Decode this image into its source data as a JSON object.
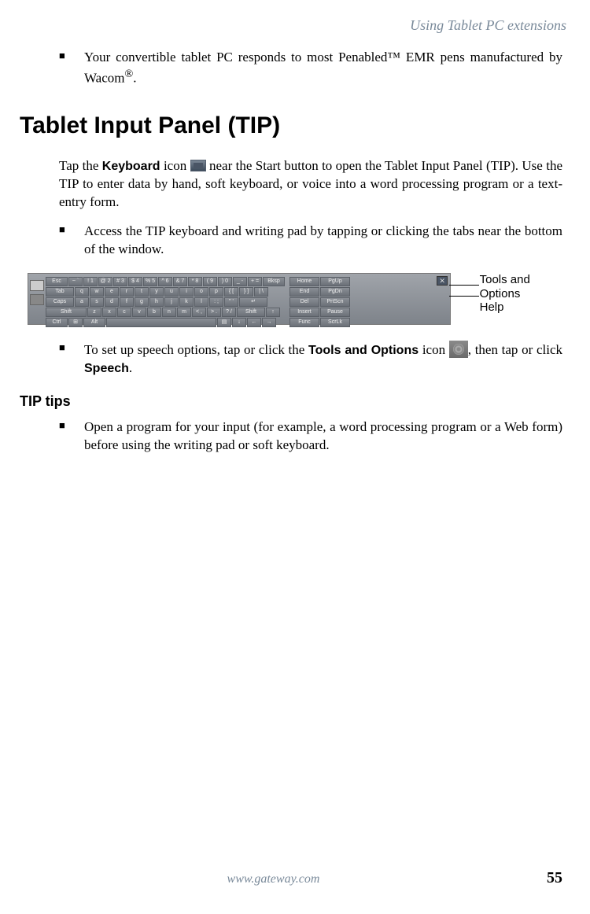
{
  "header": {
    "running_title": "Using Tablet PC extensions"
  },
  "intro_bullet": {
    "text_pre": "Your convertible tablet PC responds to most Penabled™ EMR pens manufactured by Wacom",
    "text_post": "."
  },
  "heading_main": "Tablet Input Panel (TIP)",
  "para1": {
    "pre": "Tap the ",
    "kb_label": "Keyboard",
    "mid": " icon ",
    "post": " near the Start button to open the Tablet Input Panel (TIP). Use the TIP to enter data by hand, soft keyboard, or voice into a word processing program or a text-entry form."
  },
  "bullet_access": "Access the TIP keyboard and writing pad by tapping or clicking the tabs near the bottom of the window.",
  "keyboard_rows": {
    "r1": [
      "Esc",
      "~ `",
      "! 1",
      "@ 2",
      "# 3",
      "$ 4",
      "% 5",
      "^ 6",
      "& 7",
      "* 8",
      "( 9",
      ") 0",
      "_ -",
      "+ =",
      "Bksp"
    ],
    "r2": [
      "Tab",
      "q",
      "w",
      "e",
      "r",
      "t",
      "y",
      "u",
      "i",
      "o",
      "p",
      "{ [",
      "} ]",
      "| \\"
    ],
    "r3": [
      "Caps",
      "a",
      "s",
      "d",
      "f",
      "g",
      "h",
      "j",
      "k",
      "l",
      ": ;",
      "\" '",
      "↵"
    ],
    "r4": [
      "Shift",
      "z",
      "x",
      "c",
      "v",
      "b",
      "n",
      "m",
      "< ,",
      "> .",
      "? /",
      "Shift",
      "↑"
    ],
    "r5": [
      "Ctrl",
      "⊞",
      "Alt",
      "",
      "▤",
      "↓",
      "←",
      "→"
    ],
    "nav": [
      [
        "Home",
        "PgUp"
      ],
      [
        "End",
        "PgDn"
      ],
      [
        "Del",
        "PrtScn"
      ],
      [
        "Insert",
        "Pause"
      ],
      [
        "Func",
        "ScrLk"
      ]
    ]
  },
  "callouts": {
    "tools": "Tools and Options",
    "help": "Help"
  },
  "bullet_speech": {
    "pre": "To set up speech options, tap or click the ",
    "tools_label": "Tools and Options",
    "mid": " icon ",
    "post1": ", then tap or click ",
    "speech_label": "Speech",
    "post2": "."
  },
  "subheading": "TIP tips",
  "bullet_tip": "Open a program for your input (for example, a word processing program or a Web form) before using the writing pad or soft keyboard.",
  "footer": {
    "url": "www.gateway.com",
    "page": "55"
  }
}
